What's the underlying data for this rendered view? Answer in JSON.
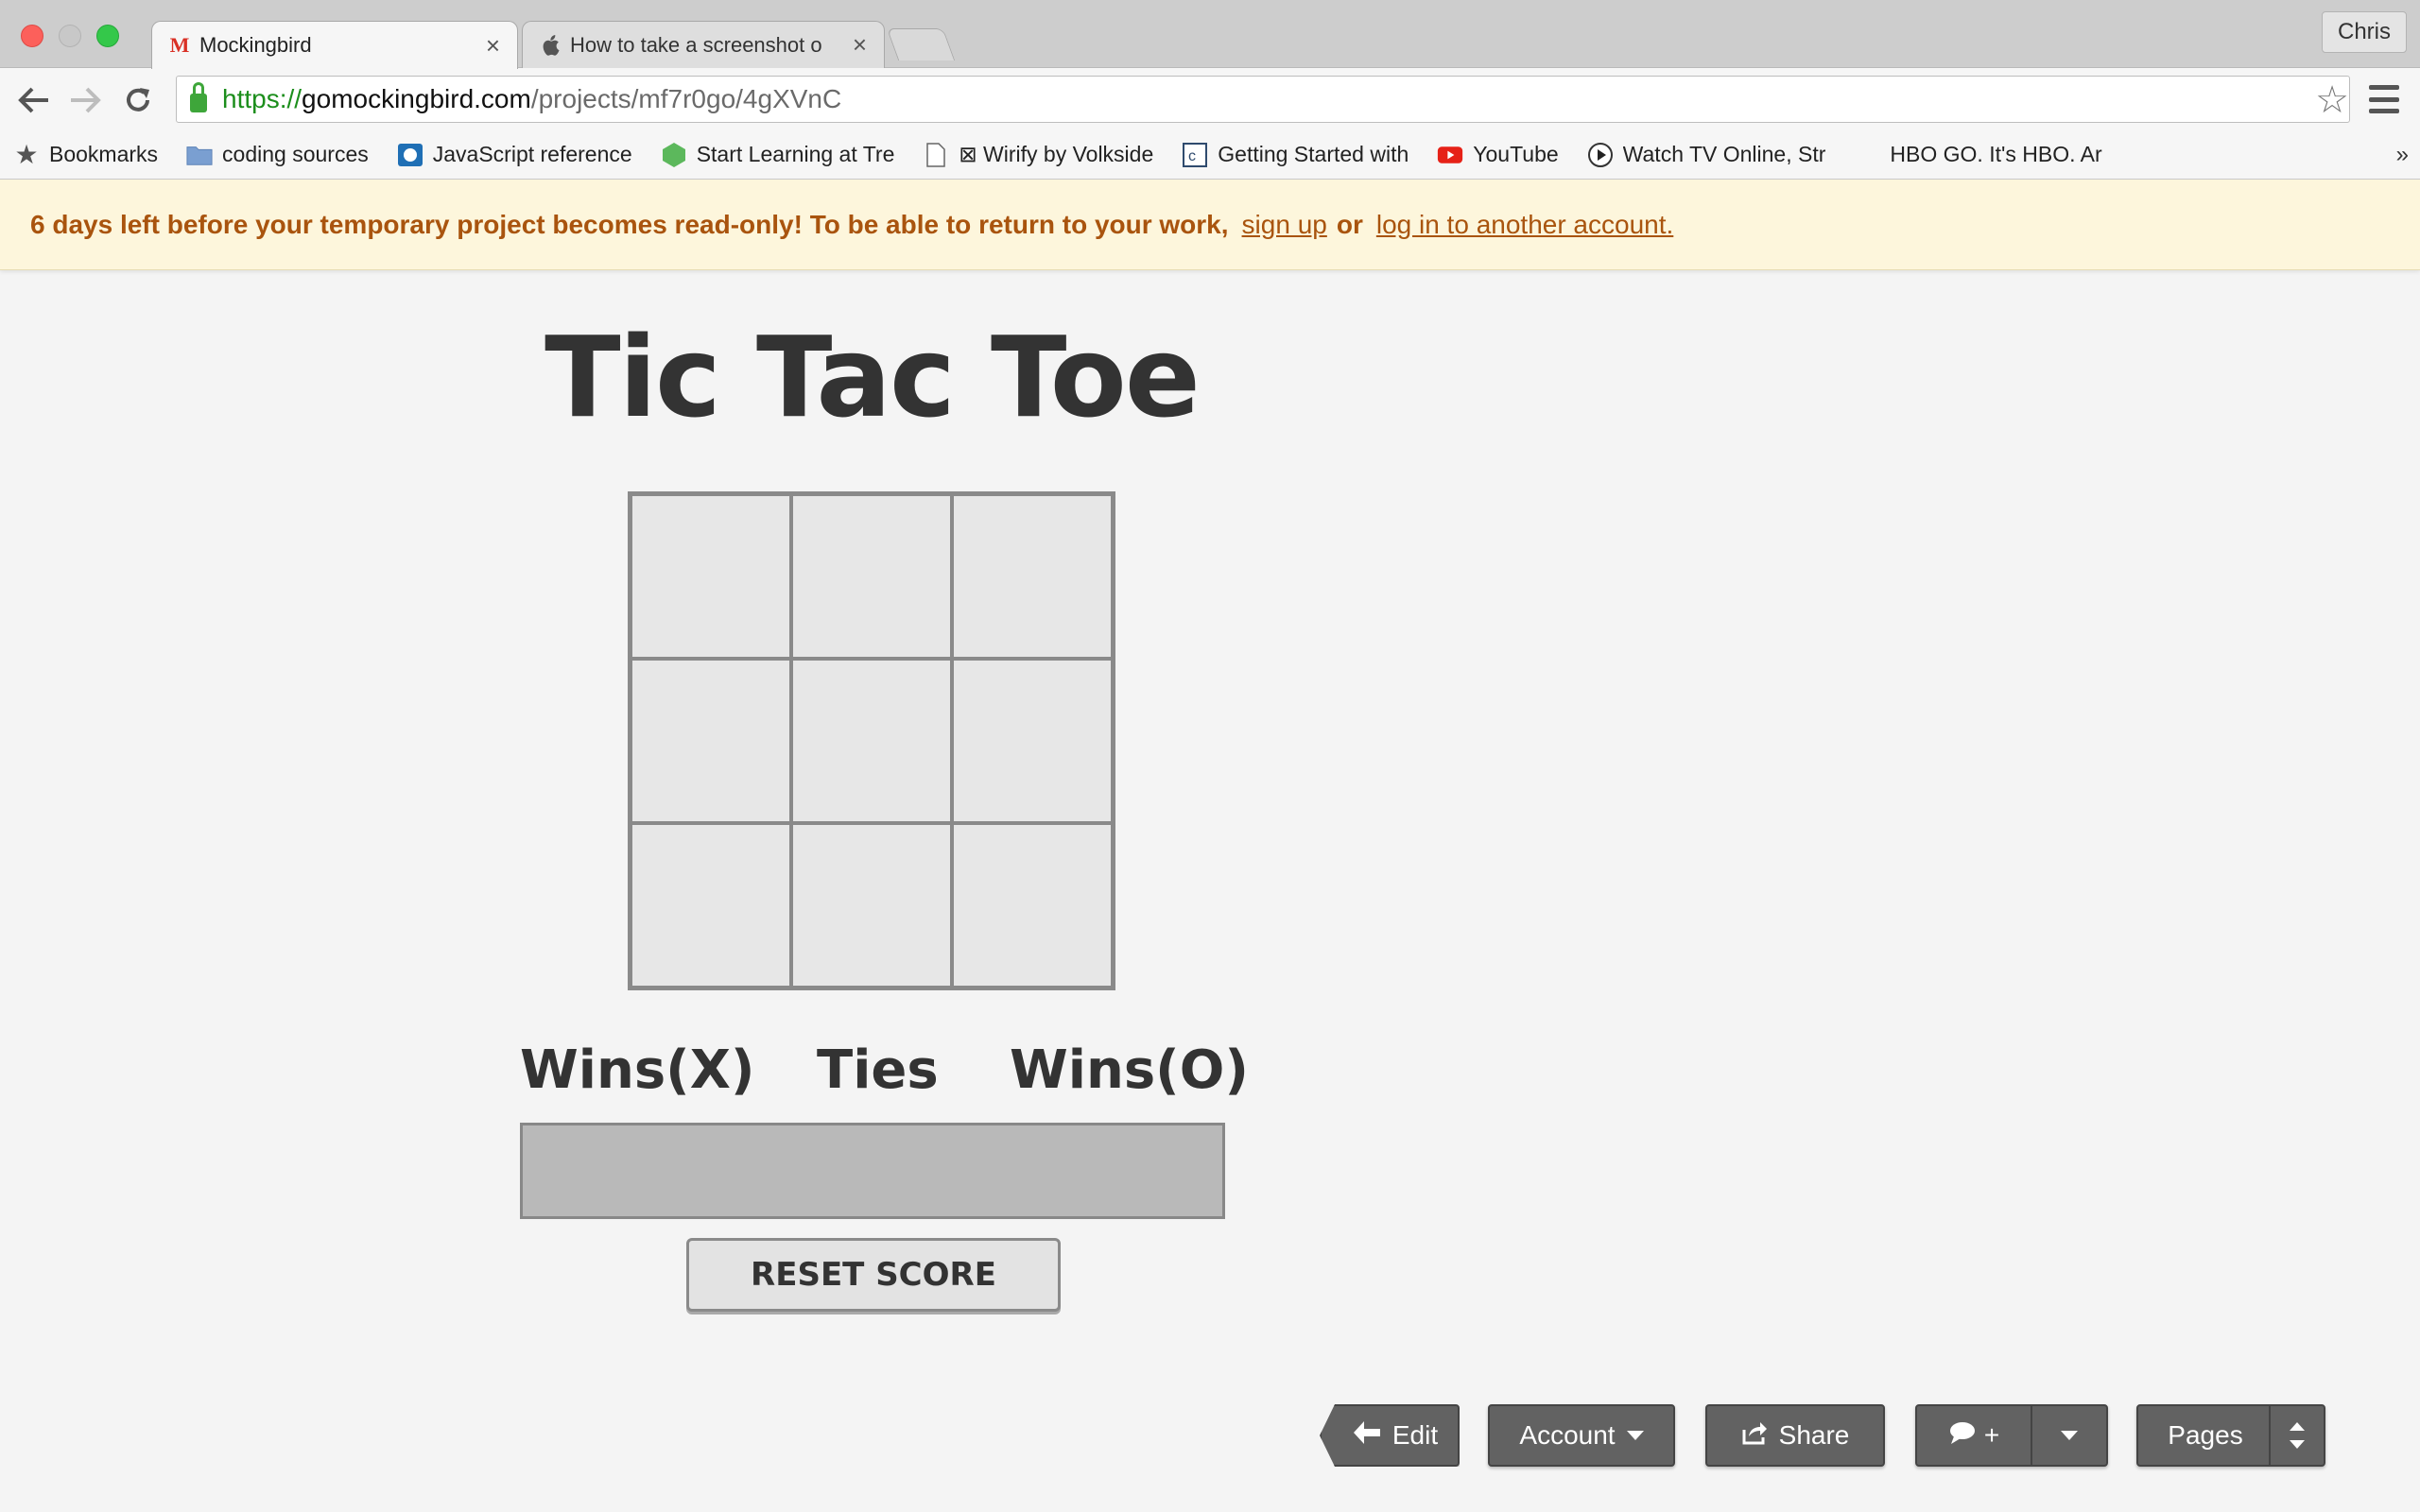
{
  "browser": {
    "tabs": [
      {
        "title": "Mockingbird",
        "favicon": "M"
      },
      {
        "title": "How to take a screenshot o",
        "favicon": "apple-icon"
      }
    ],
    "profile_name": "Chris",
    "url": {
      "scheme": "https://",
      "host": "gomockingbird.com",
      "path": "/projects/mf7r0go/4gXVnC"
    },
    "bookmarks": [
      {
        "label": "Bookmarks",
        "icon": "star-icon"
      },
      {
        "label": "coding sources",
        "icon": "folder-icon"
      },
      {
        "label": "JavaScript reference",
        "icon": "mdn-icon"
      },
      {
        "label": "Start Learning at Tre",
        "icon": "treehouse-icon"
      },
      {
        "label": "⊠ Wirify by Volkside",
        "icon": "page-icon"
      },
      {
        "label": "Getting Started with",
        "icon": "codeschool-icon"
      },
      {
        "label": "YouTube",
        "icon": "youtube-icon"
      },
      {
        "label": "Watch TV Online, Str",
        "icon": "play-icon"
      },
      {
        "label": "HBO GO. It's HBO. Ar",
        "icon": "hbo-icon"
      }
    ]
  },
  "notice": {
    "message": "6 days left before your temporary project becomes read-only! To be able to return to your work,",
    "signup_link": "sign up",
    "or_text": "or",
    "login_link": "log in to another account."
  },
  "game": {
    "title": "Tic Tac Toe",
    "board": [
      "",
      "",
      "",
      "",
      "",
      "",
      "",
      "",
      ""
    ],
    "score_headers": {
      "x": "Wins(X)",
      "ties": "Ties",
      "o": "Wins(O)"
    },
    "reset_label": "RESET SCORE"
  },
  "mockingbird_bar": {
    "edit_label": "Edit",
    "account_label": "Account",
    "share_label": "Share",
    "comment_label": "+",
    "pages_label": "Pages"
  },
  "colors": {
    "notice_text": "#a9540e",
    "notice_bg": "#fdf6dc",
    "url_green": "#1c8e1c",
    "button_dark": "#626262"
  }
}
